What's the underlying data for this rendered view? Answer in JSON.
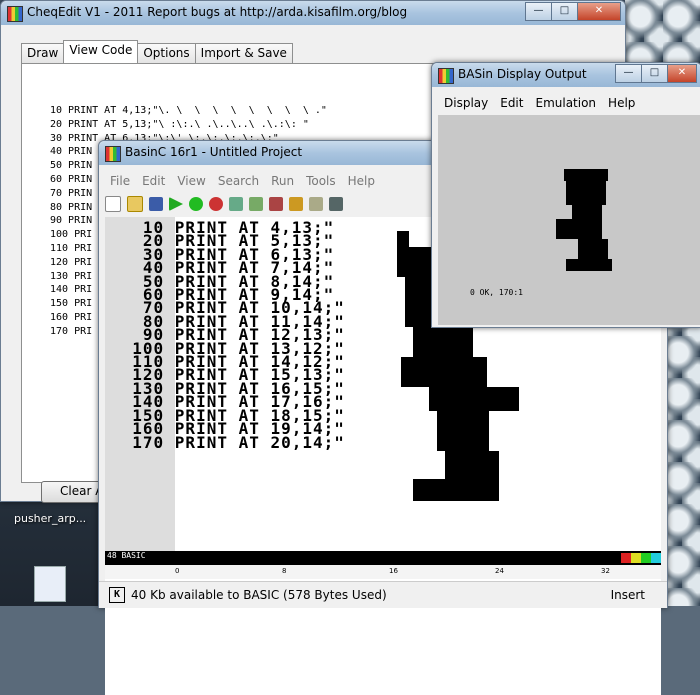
{
  "cheqedit": {
    "title": "CheqEdit V1 - 2011 Report bugs at http://arda.kisafilm.org/blog",
    "tabs": [
      "Draw",
      "View Code",
      "Options",
      "Import & Save"
    ],
    "code_lines": [
      "10 PRINT AT 4,13;\"\\. \\  \\  \\  \\  \\  \\  \\  \\ .\"",
      "20 PRINT AT 5,13;\"\\ :\\:.\\ .\\..\\..\\ .\\.:\\: \"",
      "30 PRINT AT 6,13;\"\\:\\' \\:.\\:.\\:.\\:.\\:\"",
      "40 PRIN",
      "50 PRIN",
      "60 PRIN",
      "70 PRIN",
      "80 PRIN",
      "90 PRIN",
      "100 PRI",
      "110 PRI",
      "120 PRI",
      "130 PRI",
      "140 PRI",
      "150 PRI",
      "160 PRI",
      "170 PRI"
    ],
    "clear_label": "Clear A"
  },
  "basinc": {
    "title": "BasinC 16r1 - Untitled Project",
    "menu": [
      "File",
      "Edit",
      "View",
      "Search",
      "Run",
      "Tools",
      "Help"
    ],
    "program_lines": [
      "   10 PRINT AT 4,13;\"",
      "   20 PRINT AT 5,13;\"",
      "   30 PRINT AT 6,13;\"",
      "   40 PRINT AT 7,14;\"",
      "   50 PRINT AT 8,14;\"",
      "   60 PRINT AT 9,14;\"",
      "   70 PRINT AT 10,14;\"",
      "   80 PRINT AT 11,14;\"",
      "   90 PRINT AT 12,13;\"",
      "  100 PRINT AT 13,12;\"",
      "  110 PRINT AT 14,12;\"",
      "  120 PRINT AT 15,13;\"",
      "  130 PRINT AT 16,15;\"",
      "  140 PRINT AT 17,16;\"",
      "  150 PRINT AT 18,15;\"",
      "  160 PRINT AT 19,14;\"",
      "  170 PRINT AT 20,14;\""
    ],
    "ruler_label": "48 BASIC",
    "scale": [
      "0",
      "8",
      "16",
      "24",
      "32"
    ],
    "status_key": "K",
    "status": "40 Kb available to BASIC (578 Bytes Used)",
    "mode": "Insert"
  },
  "display": {
    "title": "BASin Display Output",
    "menu": [
      "Display",
      "Edit",
      "Emulation",
      "Help"
    ],
    "ok_message": "0 OK, 170:1"
  },
  "desktop": {
    "label": "pusher_arp..."
  }
}
